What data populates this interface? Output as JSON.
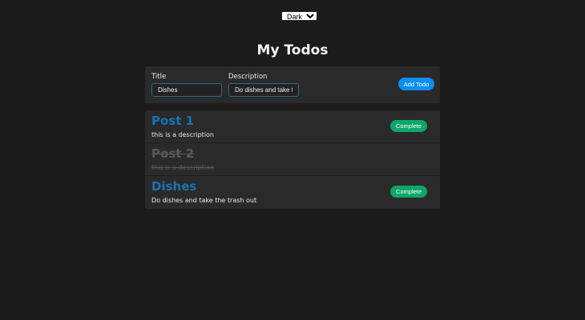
{
  "theme_select": {
    "selected": "Dark",
    "icon": "chevron-down-icon"
  },
  "page_title": "My Todos",
  "add_form": {
    "title_label": "Title",
    "title_value": "Dishes",
    "description_label": "Description",
    "description_value": "Do dishes and take the",
    "add_label": "Add Todo"
  },
  "todos": [
    {
      "title": "Post 1",
      "description": "this is a description",
      "completed": false,
      "action_label": "Complete"
    },
    {
      "title": "Post 2",
      "description": "this is a description",
      "completed": true,
      "action_label": ""
    },
    {
      "title": "Dishes",
      "description": "Do dishes and take the trash out",
      "completed": false,
      "action_label": "Complete"
    }
  ],
  "colors": {
    "background": "#1b1b1b",
    "panel": "#2a2a2a",
    "accent_blue": "#0d8ef0",
    "title_blue": "#1a72b4",
    "complete_green": "#0ea66a",
    "completed_text": "#5a5a5a"
  }
}
